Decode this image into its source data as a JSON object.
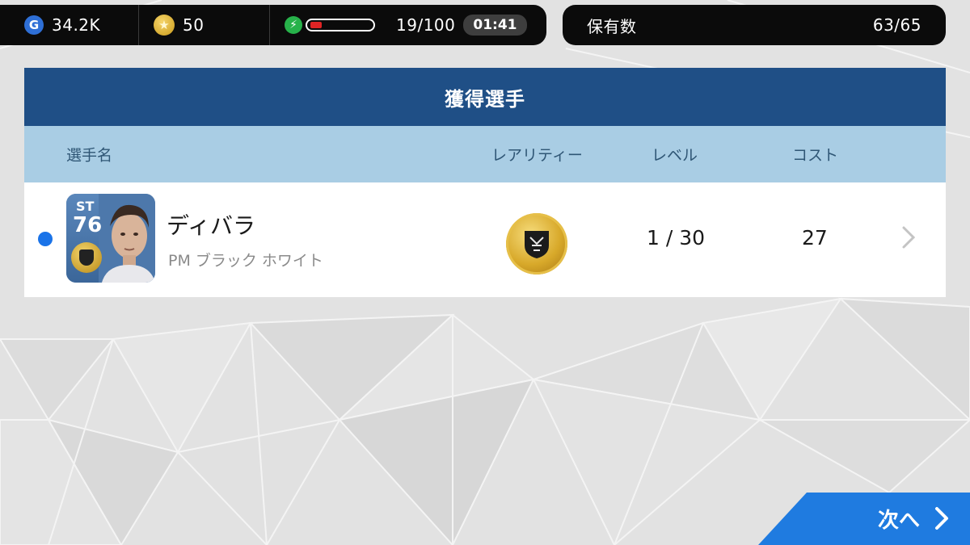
{
  "status": {
    "gp": "34.2K",
    "coins": "50",
    "energy_fraction": 0.19,
    "energy_count": "19/100",
    "timer": "01:41"
  },
  "holdings": {
    "label": "保有数",
    "value": "63/65"
  },
  "panel": {
    "title": "獲得選手",
    "columns": {
      "name": "選手名",
      "rarity": "レアリティー",
      "level": "レベル",
      "cost": "コスト"
    },
    "row": {
      "card_position": "ST",
      "card_rating": "76",
      "player_name": "ディバラ",
      "player_variant": "PM ブラック ホワイト",
      "level": "1 / 30",
      "cost": "27"
    }
  },
  "next_button": {
    "label": "次へ"
  },
  "colors": {
    "title_bar": "#1f4f86",
    "column_header": "#a9cde4",
    "accent_blue": "#1a73e8",
    "energy_red": "#e02424",
    "energy_green": "#27b24a"
  }
}
